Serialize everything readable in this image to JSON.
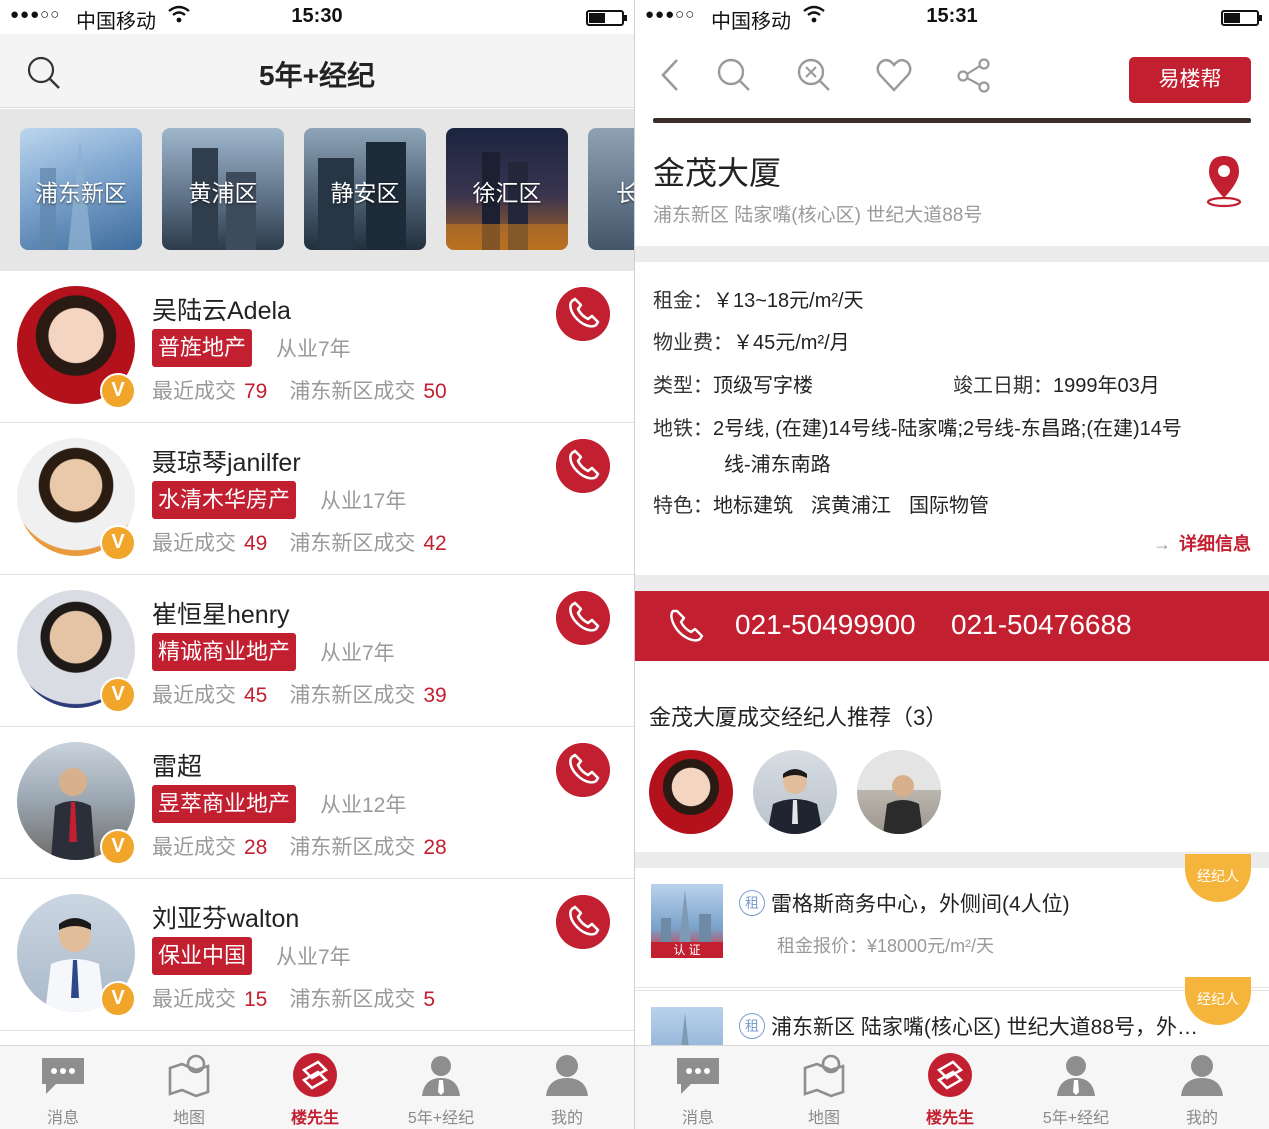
{
  "left": {
    "status": {
      "signal": "●●●○○",
      "carrier": "中国移动",
      "time": "15:30"
    },
    "header": {
      "title": "5年+经纪"
    },
    "districts": [
      "浦东新区",
      "黄浦区",
      "静安区",
      "徐汇区",
      "长"
    ],
    "agents": [
      {
        "name": "吴陆云Adela",
        "company": "普旌地产",
        "years": "从业7年",
        "recent_label": "最近成交",
        "recent": "79",
        "area_label": "浦东新区成交",
        "area": "50"
      },
      {
        "name": "聂琼琴janilfer",
        "company": "水清木华房产",
        "years": "从业17年",
        "recent_label": "最近成交",
        "recent": "49",
        "area_label": "浦东新区成交",
        "area": "42"
      },
      {
        "name": "崔恒星henry",
        "company": "精诚商业地产",
        "years": "从业7年",
        "recent_label": "最近成交",
        "recent": "45",
        "area_label": "浦东新区成交",
        "area": "39"
      },
      {
        "name": "雷超",
        "company": "昱萃商业地产",
        "years": "从业12年",
        "recent_label": "最近成交",
        "recent": "28",
        "area_label": "浦东新区成交",
        "area": "28"
      },
      {
        "name": "刘亚芬walton",
        "company": "保业中国",
        "years": "从业7年",
        "recent_label": "最近成交",
        "recent": "15",
        "area_label": "浦东新区成交",
        "area": "5"
      }
    ],
    "verified_badge": "V",
    "tabs": [
      "消息",
      "地图",
      "楼先生",
      "5年+经纪",
      "我的"
    ]
  },
  "right": {
    "status": {
      "signal": "●●●○○",
      "carrier": "中国移动",
      "time": "15:31"
    },
    "header": {
      "brand_button": "易楼帮"
    },
    "building": {
      "name": "金茂大厦",
      "address": "浦东新区 陆家嘴(核心区) 世纪大道88号",
      "rent_label": "租金：",
      "rent": "￥13~18元/m²/天",
      "fee_label": "物业费：",
      "fee": "￥45元/m²/月",
      "type_label": "类型：",
      "type": "顶级写字楼",
      "completed_label": "竣工日期：",
      "completed": "1999年03月",
      "metro_label": "地铁：",
      "metro_line1": "2号线, (在建)14号线-陆家嘴;2号线-东昌路;(在建)14号",
      "metro_line2": "线-浦东南路",
      "features_label": "特色：",
      "features": [
        "地标建筑",
        "滨黄浦江",
        "国际物管"
      ],
      "detail_link": "详细信息"
    },
    "phones": [
      "021-50499900",
      "021-50476688"
    ],
    "recommend_title": "金茂大厦成交经纪人推荐（3）",
    "listings": [
      {
        "type": "租",
        "title": "雷格斯商务中心，外侧间(4人位)",
        "price": "租金报价：¥18000元/m²/天",
        "tag": "经纪人",
        "thumb_label": "认 证"
      },
      {
        "type": "租",
        "title": "浦东新区 陆家嘴(核心区) 世纪大道88号，外…",
        "price": "",
        "tag": "经纪人",
        "thumb_label": ""
      }
    ],
    "tabs": [
      "消息",
      "地图",
      "楼先生",
      "5年+经纪",
      "我的"
    ]
  },
  "colors": {
    "accent": "#c21f30",
    "badge": "#f2a52b",
    "gray_text": "#9a9a9a"
  }
}
